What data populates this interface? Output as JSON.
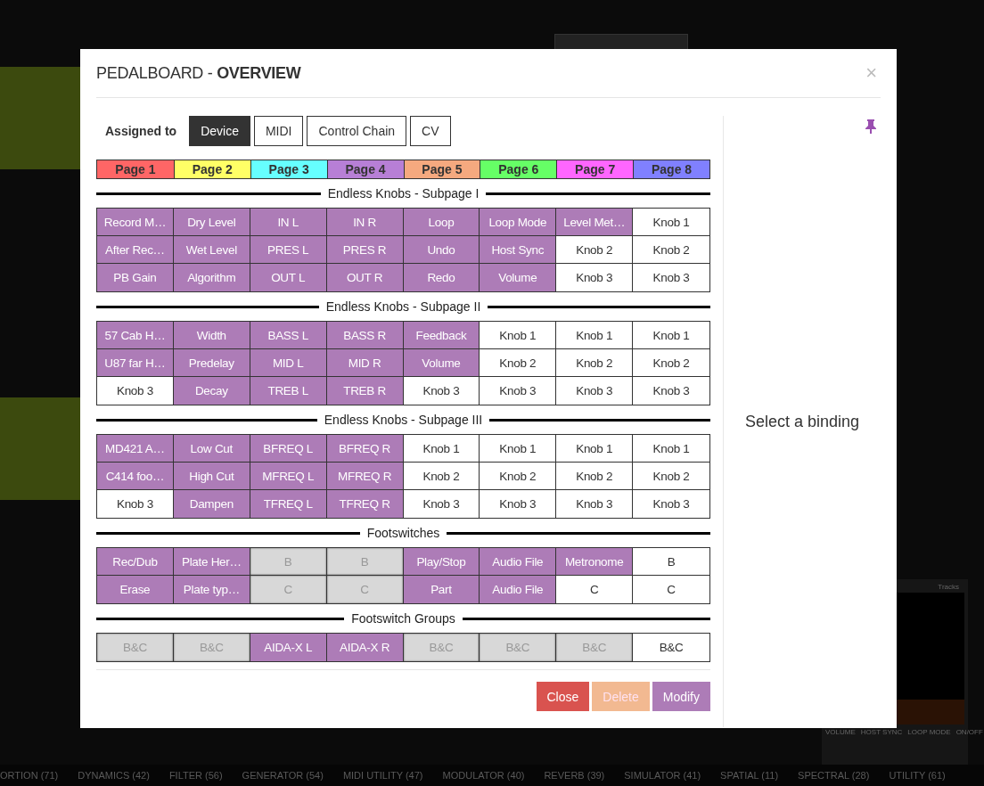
{
  "background": {
    "plugin_tab": "Tracks",
    "plugin_controls": [
      "VOLUME",
      "HOST SYNC",
      "LOOP MODE",
      "ON/OFF"
    ],
    "categories": [
      "ORTION (71)",
      "DYNAMICS (42)",
      "FILTER (56)",
      "GENERATOR (54)",
      "MIDI UTILITY (47)",
      "MODULATOR (40)",
      "REVERB (39)",
      "SIMULATOR (41)",
      "SPATIAL (11)",
      "SPECTRAL (28)",
      "UTILITY (61)"
    ]
  },
  "dialog": {
    "title_prefix": "PEDALBOARD - ",
    "title_bold": "OVERVIEW",
    "close": "×",
    "assigned_label": "Assigned to",
    "tabs": [
      {
        "label": "Device",
        "selected": true
      },
      {
        "label": "MIDI",
        "selected": false
      },
      {
        "label": "Control Chain",
        "selected": false
      },
      {
        "label": "CV",
        "selected": false
      }
    ],
    "pages": [
      {
        "label": "Page 1",
        "color": "#ff6666"
      },
      {
        "label": "Page 2",
        "color": "#ffff66"
      },
      {
        "label": "Page 3",
        "color": "#66ffff"
      },
      {
        "label": "Page 4",
        "color": "#b77fd6"
      },
      {
        "label": "Page 5",
        "color": "#f5a97f"
      },
      {
        "label": "Page 6",
        "color": "#66ff66"
      },
      {
        "label": "Page 7",
        "color": "#ff66ff"
      },
      {
        "label": "Page 8",
        "color": "#8080ff"
      }
    ],
    "sections": [
      {
        "title": "Endless Knobs - Subpage I",
        "rows": [
          [
            {
              "text": "Record M…",
              "kind": "assigned"
            },
            {
              "text": "Dry Level",
              "kind": "assigned"
            },
            {
              "text": "IN L",
              "kind": "assigned"
            },
            {
              "text": "IN R",
              "kind": "assigned"
            },
            {
              "text": "Loop",
              "kind": "assigned"
            },
            {
              "text": "Loop Mode",
              "kind": "assigned"
            },
            {
              "text": "Level Met…",
              "kind": "assigned"
            },
            {
              "text": "Knob 1",
              "kind": "free"
            }
          ],
          [
            {
              "text": "After Rec…",
              "kind": "assigned"
            },
            {
              "text": "Wet Level",
              "kind": "assigned"
            },
            {
              "text": "PRES L",
              "kind": "assigned"
            },
            {
              "text": "PRES R",
              "kind": "assigned"
            },
            {
              "text": "Undo",
              "kind": "assigned"
            },
            {
              "text": "Host Sync",
              "kind": "assigned"
            },
            {
              "text": "Knob 2",
              "kind": "free"
            },
            {
              "text": "Knob 2",
              "kind": "free"
            }
          ],
          [
            {
              "text": "PB Gain",
              "kind": "assigned"
            },
            {
              "text": "Algorithm",
              "kind": "assigned"
            },
            {
              "text": "OUT L",
              "kind": "assigned"
            },
            {
              "text": "OUT R",
              "kind": "assigned"
            },
            {
              "text": "Redo",
              "kind": "assigned"
            },
            {
              "text": "Volume",
              "kind": "assigned"
            },
            {
              "text": "Knob 3",
              "kind": "free"
            },
            {
              "text": "Knob 3",
              "kind": "free"
            }
          ]
        ]
      },
      {
        "title": "Endless Knobs - Subpage II",
        "rows": [
          [
            {
              "text": "57 Cab H…",
              "kind": "assigned"
            },
            {
              "text": "Width",
              "kind": "assigned"
            },
            {
              "text": "BASS L",
              "kind": "assigned"
            },
            {
              "text": "BASS R",
              "kind": "assigned"
            },
            {
              "text": "Feedback",
              "kind": "assigned"
            },
            {
              "text": "Knob 1",
              "kind": "free"
            },
            {
              "text": "Knob 1",
              "kind": "free"
            },
            {
              "text": "Knob 1",
              "kind": "free"
            }
          ],
          [
            {
              "text": "U87 far H…",
              "kind": "assigned"
            },
            {
              "text": "Predelay",
              "kind": "assigned"
            },
            {
              "text": "MID L",
              "kind": "assigned"
            },
            {
              "text": "MID R",
              "kind": "assigned"
            },
            {
              "text": "Volume",
              "kind": "assigned"
            },
            {
              "text": "Knob 2",
              "kind": "free"
            },
            {
              "text": "Knob 2",
              "kind": "free"
            },
            {
              "text": "Knob 2",
              "kind": "free"
            }
          ],
          [
            {
              "text": "Knob 3",
              "kind": "free"
            },
            {
              "text": "Decay",
              "kind": "assigned"
            },
            {
              "text": "TREB L",
              "kind": "assigned"
            },
            {
              "text": "TREB R",
              "kind": "assigned"
            },
            {
              "text": "Knob 3",
              "kind": "free"
            },
            {
              "text": "Knob 3",
              "kind": "free"
            },
            {
              "text": "Knob 3",
              "kind": "free"
            },
            {
              "text": "Knob 3",
              "kind": "free"
            }
          ]
        ]
      },
      {
        "title": "Endless Knobs - Subpage III",
        "rows": [
          [
            {
              "text": "MD421 A…",
              "kind": "assigned"
            },
            {
              "text": "Low Cut",
              "kind": "assigned"
            },
            {
              "text": "BFREQ L",
              "kind": "assigned"
            },
            {
              "text": "BFREQ R",
              "kind": "assigned"
            },
            {
              "text": "Knob 1",
              "kind": "free"
            },
            {
              "text": "Knob 1",
              "kind": "free"
            },
            {
              "text": "Knob 1",
              "kind": "free"
            },
            {
              "text": "Knob 1",
              "kind": "free"
            }
          ],
          [
            {
              "text": "C414 foo…",
              "kind": "assigned"
            },
            {
              "text": "High Cut",
              "kind": "assigned"
            },
            {
              "text": "MFREQ L",
              "kind": "assigned"
            },
            {
              "text": "MFREQ R",
              "kind": "assigned"
            },
            {
              "text": "Knob 2",
              "kind": "free"
            },
            {
              "text": "Knob 2",
              "kind": "free"
            },
            {
              "text": "Knob 2",
              "kind": "free"
            },
            {
              "text": "Knob 2",
              "kind": "free"
            }
          ],
          [
            {
              "text": "Knob 3",
              "kind": "free"
            },
            {
              "text": "Dampen",
              "kind": "assigned"
            },
            {
              "text": "TFREQ L",
              "kind": "assigned"
            },
            {
              "text": "TFREQ R",
              "kind": "assigned"
            },
            {
              "text": "Knob 3",
              "kind": "free"
            },
            {
              "text": "Knob 3",
              "kind": "free"
            },
            {
              "text": "Knob 3",
              "kind": "free"
            },
            {
              "text": "Knob 3",
              "kind": "free"
            }
          ]
        ]
      },
      {
        "title": "Footswitches",
        "rows": [
          [
            {
              "text": "Rec/Dub",
              "kind": "assigned"
            },
            {
              "text": "Plate Her…",
              "kind": "assigned"
            },
            {
              "text": "B",
              "kind": "unavailable"
            },
            {
              "text": "B",
              "kind": "unavailable"
            },
            {
              "text": "Play/Stop",
              "kind": "assigned"
            },
            {
              "text": "Audio File",
              "kind": "assigned"
            },
            {
              "text": "Metronome",
              "kind": "assigned"
            },
            {
              "text": "B",
              "kind": "free"
            }
          ],
          [
            {
              "text": "Erase",
              "kind": "assigned"
            },
            {
              "text": "Plate typ…",
              "kind": "assigned"
            },
            {
              "text": "C",
              "kind": "unavailable"
            },
            {
              "text": "C",
              "kind": "unavailable"
            },
            {
              "text": "Part",
              "kind": "assigned"
            },
            {
              "text": "Audio File",
              "kind": "assigned"
            },
            {
              "text": "C",
              "kind": "free"
            },
            {
              "text": "C",
              "kind": "free"
            }
          ]
        ]
      },
      {
        "title": "Footswitch Groups",
        "rows": [
          [
            {
              "text": "B&C",
              "kind": "unavailable"
            },
            {
              "text": "B&C",
              "kind": "unavailable"
            },
            {
              "text": "AIDA-X L",
              "kind": "assigned"
            },
            {
              "text": "AIDA-X R",
              "kind": "assigned"
            },
            {
              "text": "B&C",
              "kind": "unavailable"
            },
            {
              "text": "B&C",
              "kind": "unavailable"
            },
            {
              "text": "B&C",
              "kind": "unavailable"
            },
            {
              "text": "B&C",
              "kind": "free"
            }
          ]
        ]
      }
    ],
    "side_message": "Select a binding",
    "buttons": [
      {
        "label": "Close",
        "kind": "danger",
        "disabled": false
      },
      {
        "label": "Delete",
        "kind": "warning",
        "disabled": true
      },
      {
        "label": "Modify",
        "kind": "primary",
        "disabled": false
      }
    ]
  }
}
